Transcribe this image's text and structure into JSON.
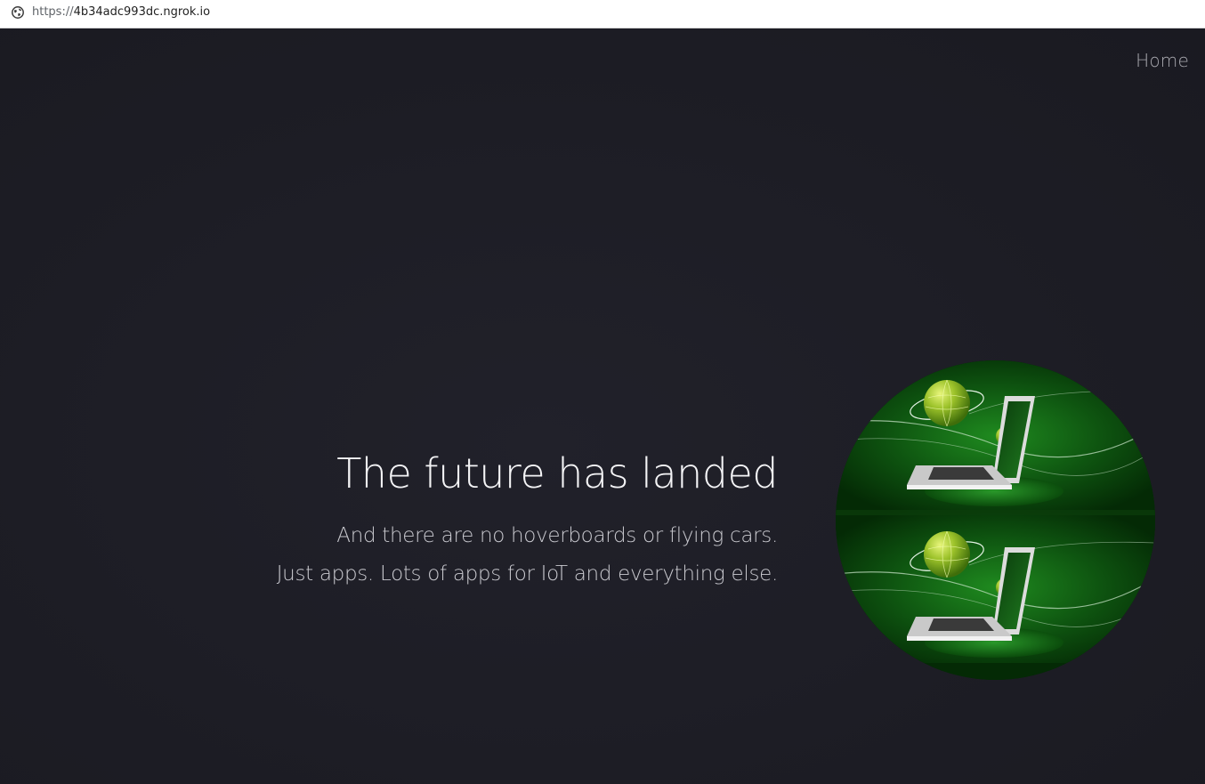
{
  "browser": {
    "url_scheme": "https://",
    "url_host": "4b34adc993dc.ngrok.io",
    "globe_icon": "globe-icon"
  },
  "nav": {
    "home_label": "Home"
  },
  "hero": {
    "title": "The future has landed",
    "subtitle_line1": "And there are no hoverboards or flying cars.",
    "subtitle_line2": "Just apps. Lots of apps for IoT and everything else.",
    "image_icon": "laptop-globe-illustration"
  },
  "colors": {
    "page_background": "#1c1c24",
    "title_text": "#f4f4f6",
    "subtitle_text": "#c9c9cf",
    "nav_text": "#a9a9b0",
    "image_green": "#1f7a1f"
  }
}
